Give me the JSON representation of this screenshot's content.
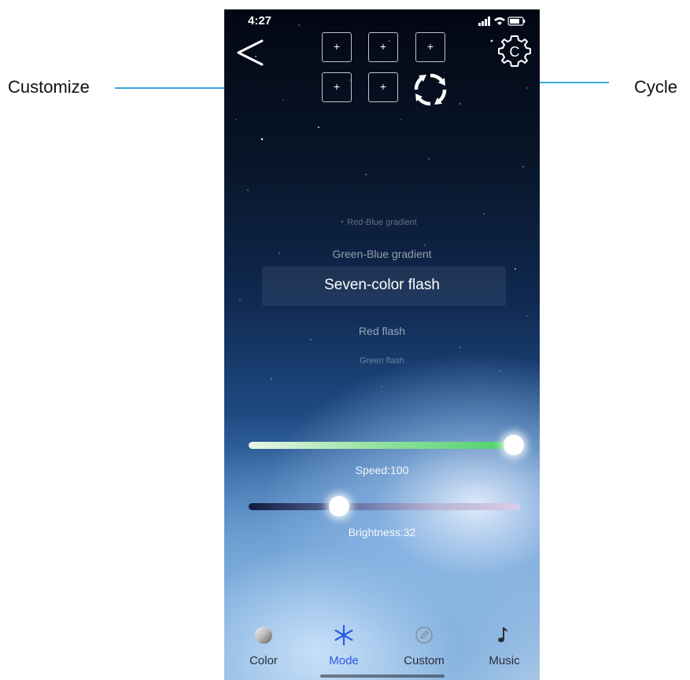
{
  "callouts": {
    "customize": "Customize",
    "cycle": "Cycle"
  },
  "status_bar": {
    "time": "4:27"
  },
  "header": {
    "back_icon": "back-chevron-icon",
    "settings_icon": "settings-gear-icon",
    "slots": [
      "+",
      "+",
      "+",
      "+",
      "+"
    ],
    "cycle_icon": "cycle-icon"
  },
  "mode_picker": {
    "items": [
      "Red-Blue gradient",
      "Green-Blue gradient",
      "Seven-color flash",
      "Red flash",
      "Green flash"
    ],
    "selected": "Seven-color flash"
  },
  "speed": {
    "label": "Speed:100",
    "value": 100,
    "max": 100,
    "color": "#4cd36b"
  },
  "brightness": {
    "label": "Brightness:32",
    "value": 32,
    "max": 100
  },
  "tab_bar": {
    "tabs": [
      {
        "label": "Color",
        "icon": "color-disc-icon"
      },
      {
        "label": "Mode",
        "icon": "snowflake-icon"
      },
      {
        "label": "Custom",
        "icon": "custom-edit-icon"
      },
      {
        "label": "Music",
        "icon": "music-note-icon"
      }
    ],
    "active": "Mode",
    "active_color": "#2f5be6"
  },
  "colors": {
    "callout_line": "#39a6dc"
  }
}
